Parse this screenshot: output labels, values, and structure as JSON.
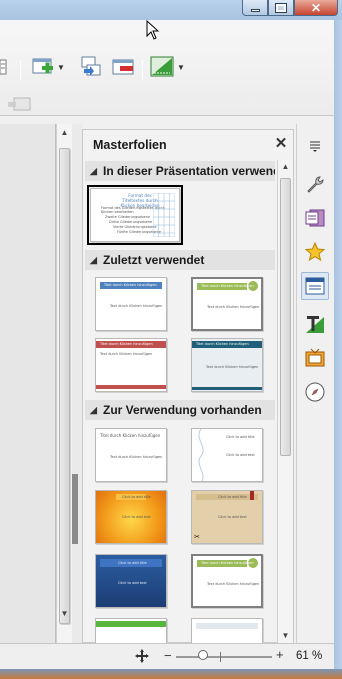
{
  "sidebar": {
    "title": "Masterfolien",
    "close_label": "✕",
    "sections": [
      {
        "heading": "In dieser Präsentation verwend"
      },
      {
        "heading": "Zuletzt verwendet"
      },
      {
        "heading": "Zur Verwendung vorhanden"
      }
    ],
    "current_thumb": {
      "title": "Format des Titeltextes durch Klicken bearbeiten",
      "lines": [
        "Format des Gliederungstextes durch",
        "Klicken bearbeiten",
        "Zweite Gliederungsebene",
        "Dritte Gliederungsebene",
        "Vierte Gliederungsebene",
        "Fünfte Gliederungsebene"
      ]
    },
    "recent_thumbs": [
      {
        "title": "Titel durch Klicken hinzufügen",
        "body": "Text durch Klicken hinzufügen",
        "color": "#4f81bd"
      },
      {
        "title": "Titel durch Klicken hinzufügen",
        "body": "Text durch Klicken hinzufügen",
        "color": "#9bbb59"
      },
      {
        "title": "Titel durch Klicken hinzufügen",
        "body": "Text durch Klicken hinzufügen",
        "color": "#c0504d"
      },
      {
        "title": "Titel durch Klicken hinzufügen",
        "body": "Text durch Klicken hinzufügen",
        "color": "#1f5f7a"
      }
    ],
    "available_thumbs": [
      {
        "title": "Titel durch Klicken hinzufügen",
        "body": "Text durch Klicken hinzufügen"
      },
      {
        "title": "Click to add title",
        "body": "Click to add text"
      },
      {
        "title": "Click to add title",
        "body": "Click to add text"
      },
      {
        "title": "Click to add title",
        "body": "Click to add text"
      },
      {
        "title": "Click to add title",
        "body": "Click to add text"
      },
      {
        "title": "Titel durch Klicken hinzufügen",
        "body": "Text durch Klicken hinzufügen"
      }
    ]
  },
  "statusbar": {
    "zoom_value": "61 %",
    "zoom_minus": "−",
    "zoom_plus": "+"
  },
  "colors": {
    "accent_blue": "#4f81bd",
    "accent_green": "#9bbb59",
    "accent_red": "#c0504d",
    "accent_orange": "#f79646"
  }
}
